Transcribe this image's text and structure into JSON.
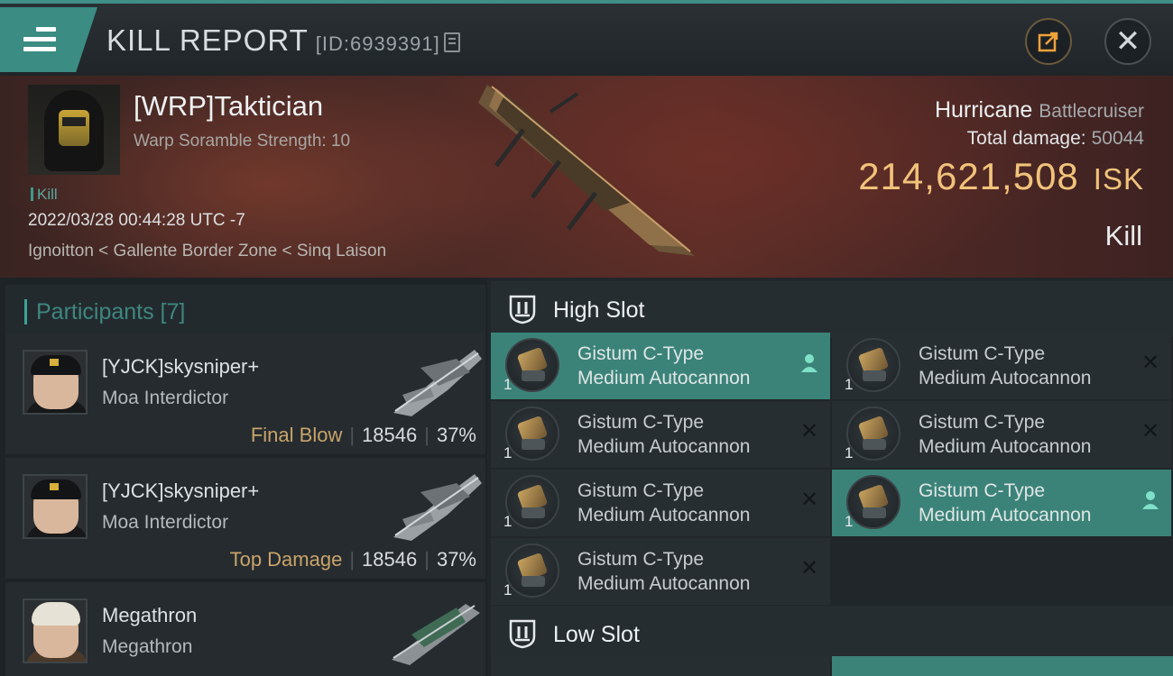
{
  "header": {
    "title": "KILL REPORT",
    "report_id": "[ID:6939391]"
  },
  "victim": {
    "name": "[WRP]Taktician",
    "subtitle": "Warp Soramble Strength: 10",
    "tag": "Kill",
    "datetime": "2022/03/28 00:44:28 UTC -7",
    "location": "Ignoitton < Gallente Border Zone < Sinq Laison",
    "ship_name": "Hurricane",
    "ship_class": "Battlecruiser",
    "total_damage_label": "Total damage:",
    "total_damage": "50044",
    "isk_value": "214,621,508",
    "isk_unit": "ISK",
    "result": "Kill"
  },
  "participants": {
    "title": "Participants [7]",
    "items": [
      {
        "name": "[YJCK]skysniper+",
        "ship": "Moa Interdictor",
        "tag": "Final Blow",
        "damage": "18546",
        "percent": "37%"
      },
      {
        "name": "[YJCK]skysniper+",
        "ship": "Moa Interdictor",
        "tag": "Top Damage",
        "damage": "18546",
        "percent": "37%"
      },
      {
        "name": "Megathron",
        "ship": "Megathron"
      }
    ]
  },
  "slots": {
    "high_slot_label": "High Slot",
    "low_slot_label": "Low Slot",
    "modules": [
      {
        "line1": "Gistum C-Type",
        "line2": "Medium Autocannon",
        "qty": "1",
        "state": "person"
      },
      {
        "line1": "Gistum C-Type",
        "line2": "Medium Autocannon",
        "qty": "1",
        "state": "x"
      },
      {
        "line1": "Gistum C-Type",
        "line2": "Medium Autocannon",
        "qty": "1",
        "state": "x"
      },
      {
        "line1": "Gistum C-Type",
        "line2": "Medium Autocannon",
        "qty": "1",
        "state": "x"
      },
      {
        "line1": "Gistum C-Type",
        "line2": "Medium Autocannon",
        "qty": "1",
        "state": "x"
      },
      {
        "line1": "Gistum C-Type",
        "line2": "Medium Autocannon",
        "qty": "1",
        "state": "person"
      },
      {
        "line1": "Gistum C-Type",
        "line2": "Medium Autocannon",
        "qty": "1",
        "state": "x"
      }
    ]
  },
  "icons": {
    "menu": "hamburger-icon",
    "copy": "copy-icon",
    "share": "share-icon",
    "close": "close-icon",
    "slot": "slot-shield-icon"
  },
  "colors": {
    "accent": "#3b8c82",
    "isk": "#f1c27a",
    "tag": "#c9a46a"
  }
}
